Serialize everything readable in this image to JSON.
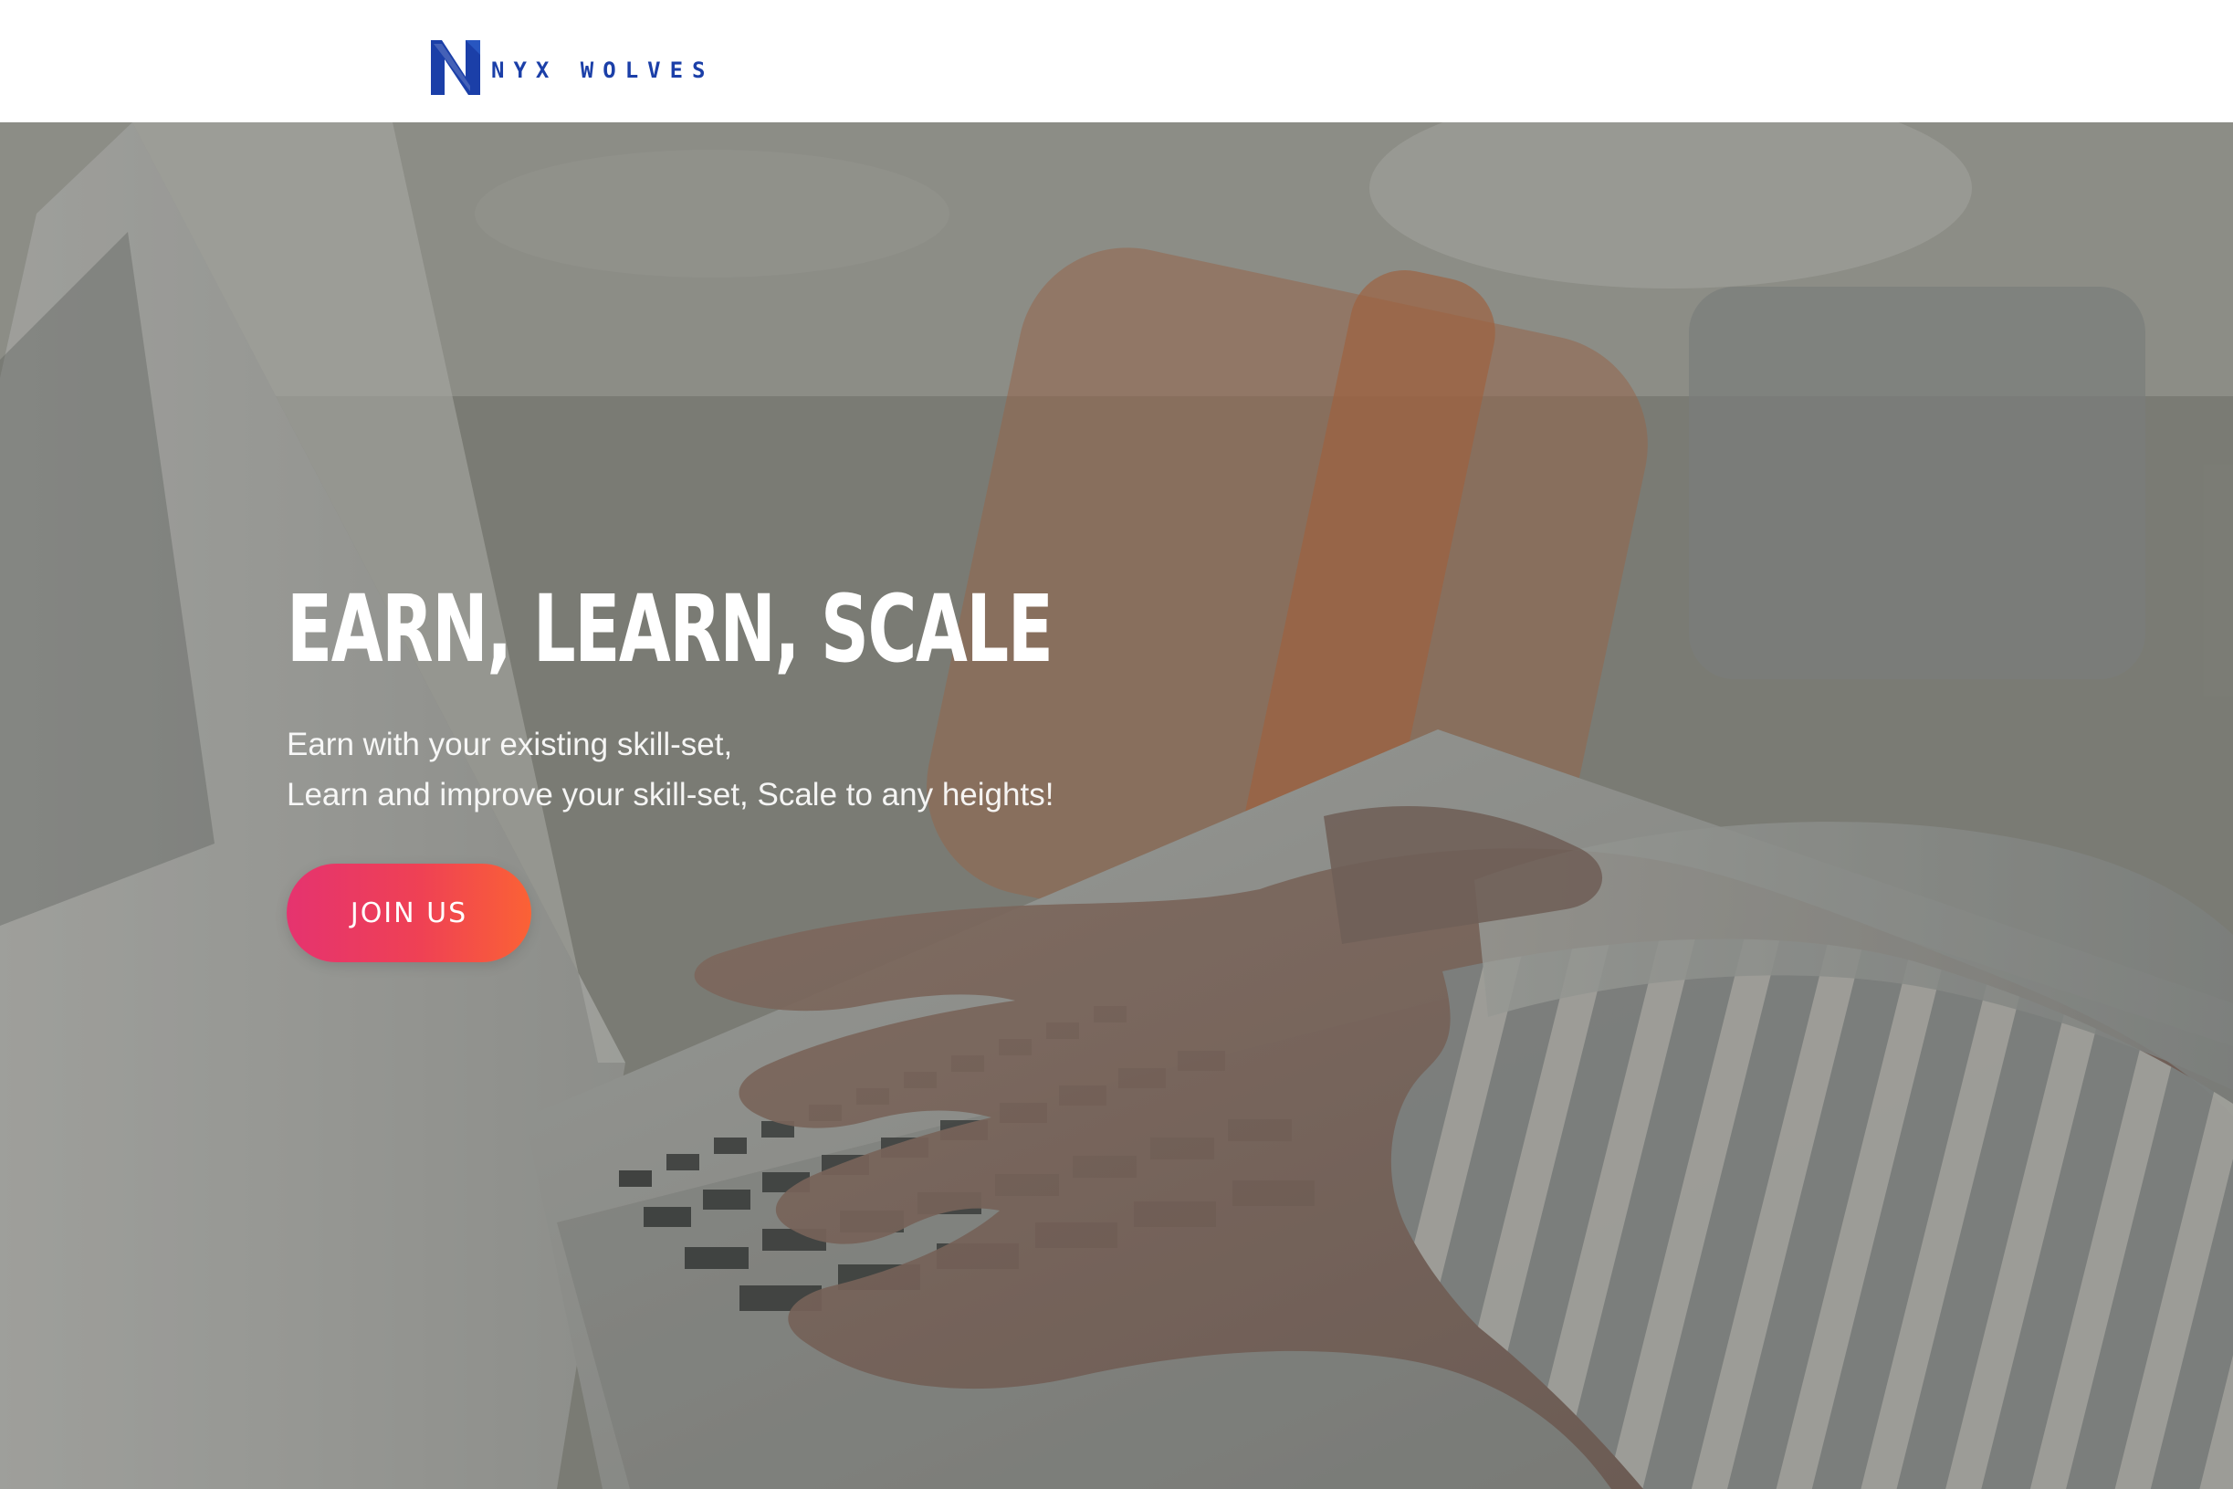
{
  "header": {
    "brand": "NYX WOLVES",
    "logo_icon": "wolf-n-logo-icon"
  },
  "hero": {
    "headline": "EARN, LEARN, SCALE",
    "subtext_line_1": "Earn with your existing skill-set,",
    "subtext_line_2": "Learn and improve your skill-set, Scale to any heights!",
    "cta_label": "JOIN US",
    "image_icon": "laptop-typing-photo"
  },
  "colors": {
    "brand_blue": "#1b3fa8",
    "cta_start": "#e5336f",
    "cta_end": "#fb6235",
    "text_white": "#ffffff"
  }
}
